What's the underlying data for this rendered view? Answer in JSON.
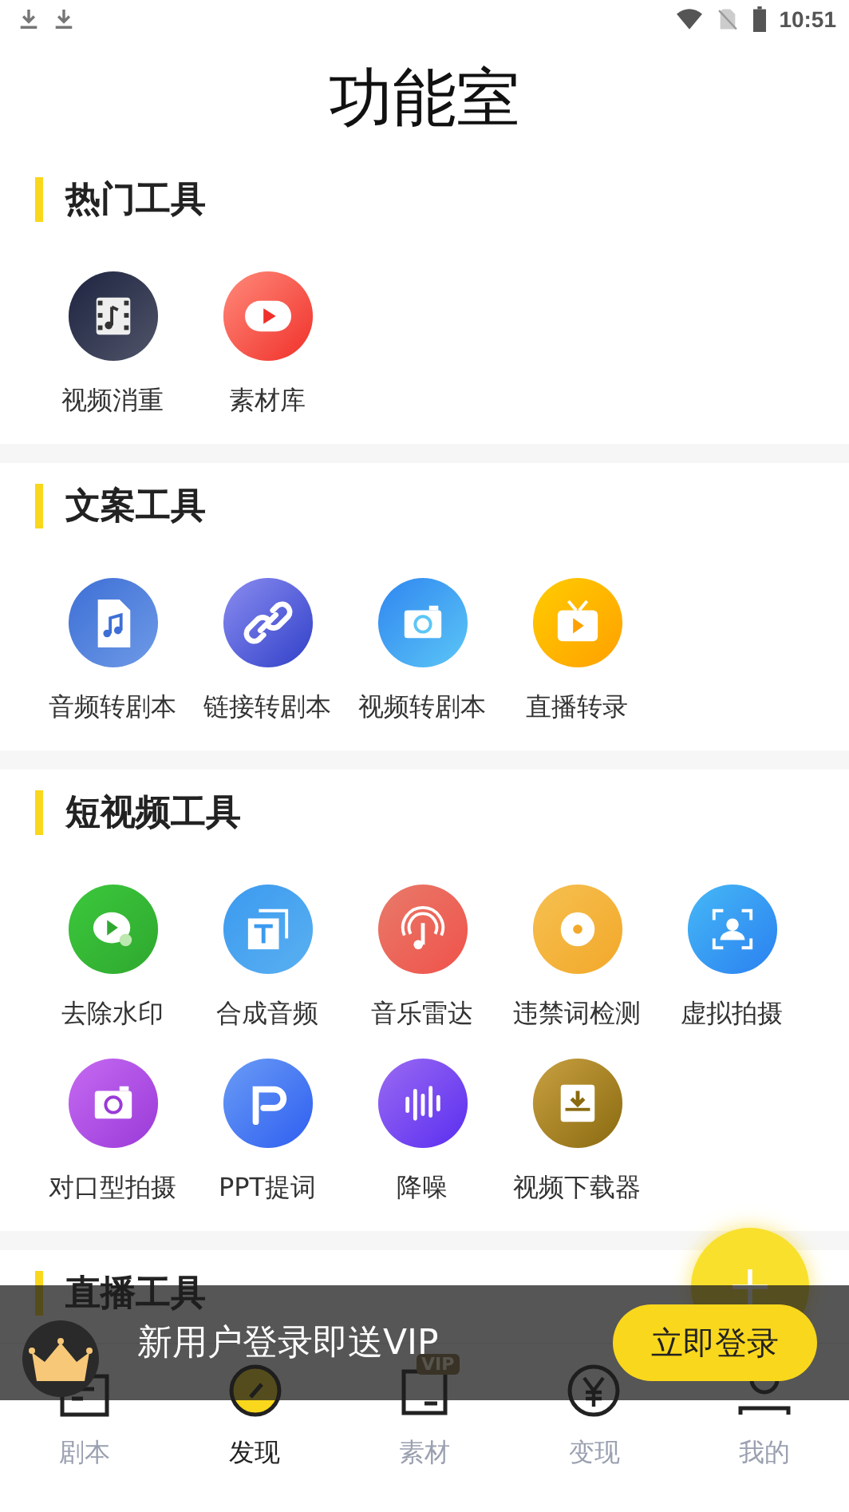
{
  "status_bar": {
    "time": "10:51"
  },
  "title": "功能室",
  "sections": [
    {
      "title": "热门工具",
      "tools": [
        {
          "label": "视频消重"
        },
        {
          "label": "素材库"
        }
      ]
    },
    {
      "title": "文案工具",
      "tools": [
        {
          "label": "音频转剧本"
        },
        {
          "label": "链接转剧本"
        },
        {
          "label": "视频转剧本"
        },
        {
          "label": "直播转录"
        }
      ]
    },
    {
      "title": "短视频工具",
      "tools": [
        {
          "label": "去除水印"
        },
        {
          "label": "合成音频"
        },
        {
          "label": "音乐雷达"
        },
        {
          "label": "违禁词检测"
        },
        {
          "label": "虚拟拍摄"
        },
        {
          "label": "对口型拍摄"
        },
        {
          "label": "PPT提词"
        },
        {
          "label": "降噪"
        },
        {
          "label": "视频下载器"
        }
      ]
    },
    {
      "title": "直播工具"
    }
  ],
  "login_banner": {
    "text": "新用户登录即送VIP",
    "button": "立即登录"
  },
  "tabs": [
    {
      "label": "剧本",
      "selected": false
    },
    {
      "label": "发现",
      "selected": true
    },
    {
      "label": "素材",
      "selected": false,
      "badge": "VIP"
    },
    {
      "label": "变现",
      "selected": false
    },
    {
      "label": "我的",
      "selected": false
    }
  ]
}
